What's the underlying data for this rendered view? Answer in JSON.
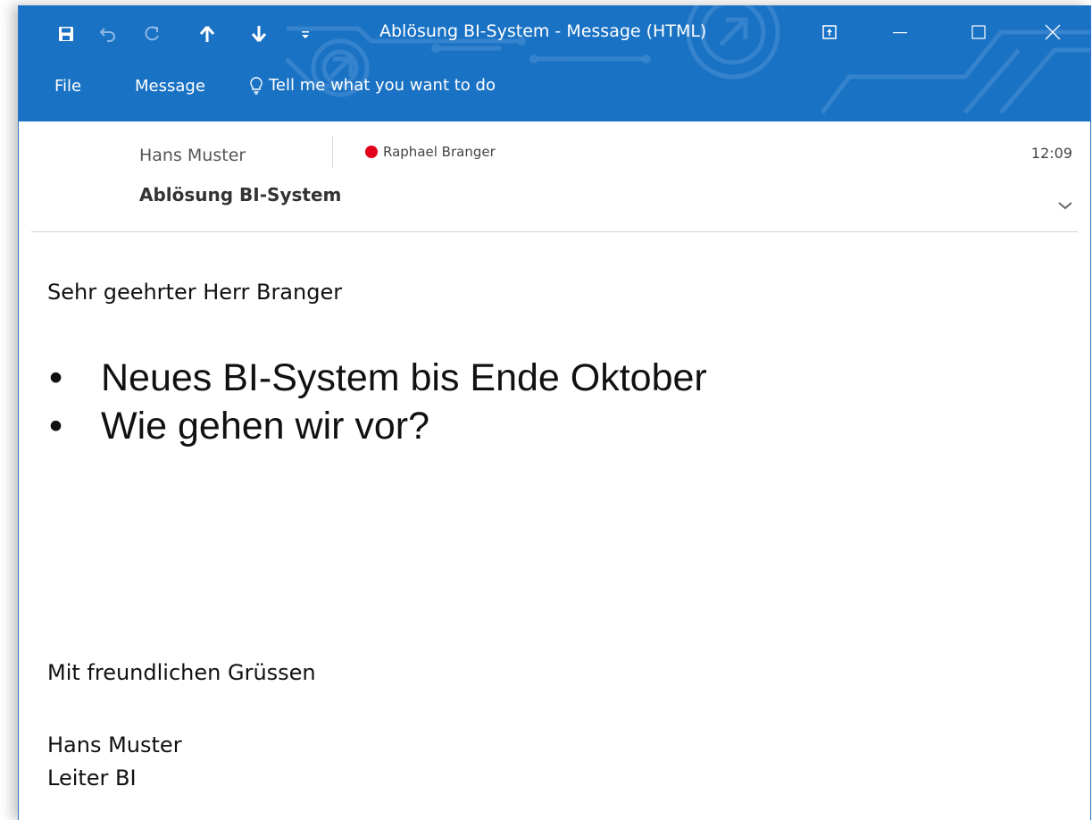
{
  "window": {
    "title": "Ablösung BI-System  -  Message (HTML)"
  },
  "quick_access": {
    "icons": [
      "save-icon",
      "undo-icon",
      "redo-icon",
      "previous-item-icon",
      "next-item-icon",
      "customize-qat-icon"
    ]
  },
  "window_controls": {
    "icons": [
      "ribbon-display-options-icon",
      "minimize-icon",
      "maximize-icon",
      "close-icon"
    ]
  },
  "menu": {
    "file_label": "File",
    "message_label": "Message",
    "tell_me_label": "Tell me what you want to do"
  },
  "header": {
    "from": "Hans Muster",
    "to": "Raphael Branger",
    "presence_color": "#e3001b",
    "time": "12:09",
    "subject": "Ablösung BI-System"
  },
  "body": {
    "greeting": "Sehr geehrter Herr Branger",
    "bullets": [
      "Neues BI-System bis Ende Oktober",
      "Wie gehen wir vor?"
    ],
    "closing": "Mit freundlichen Grüssen",
    "signature_name": "Hans Muster",
    "signature_title": "Leiter BI"
  },
  "colors": {
    "accent": "#1a72c4"
  }
}
